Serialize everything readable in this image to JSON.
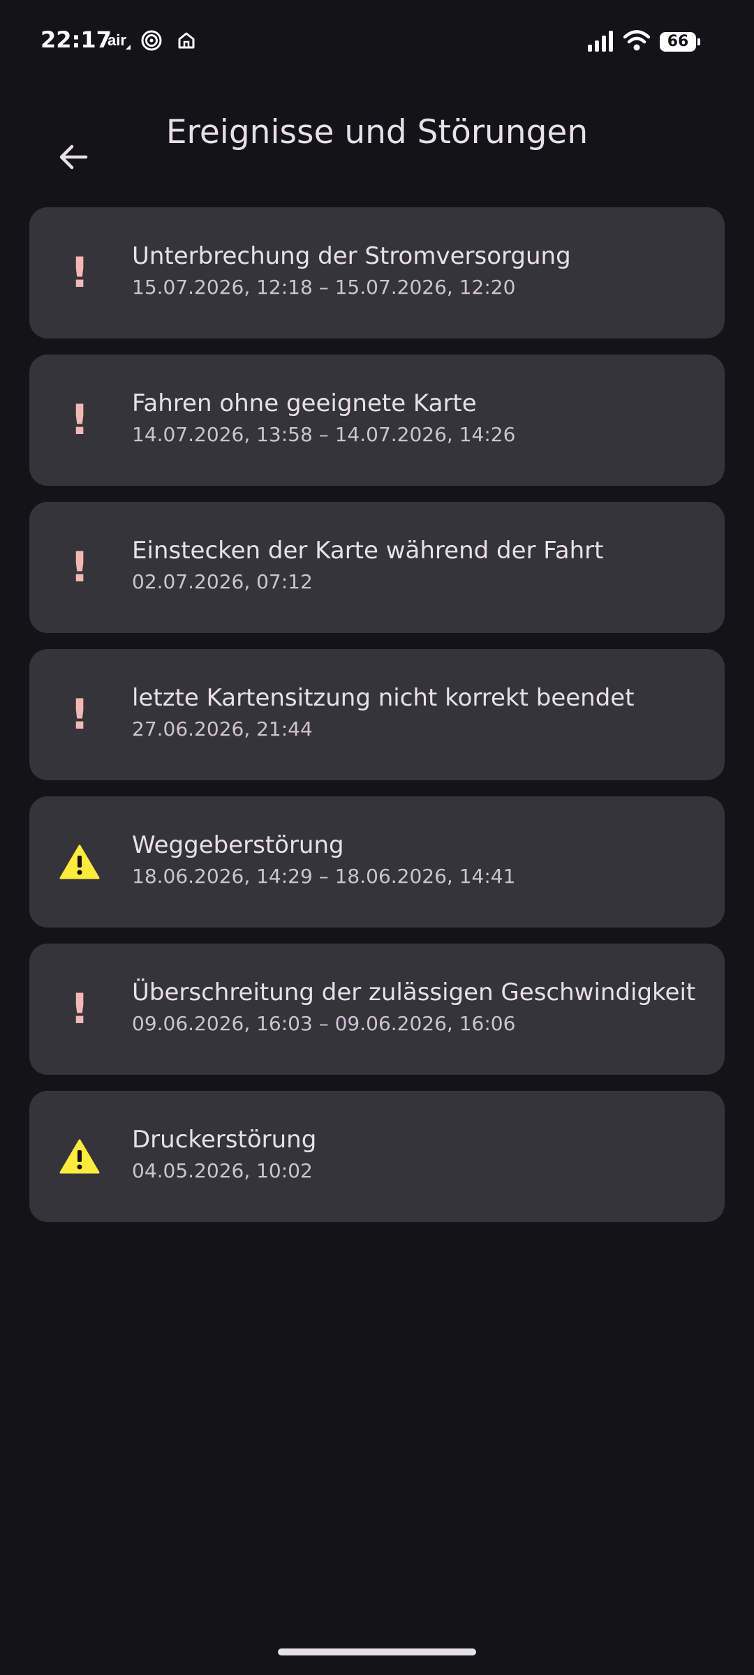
{
  "status_bar": {
    "time": "22:17",
    "air_label": "air",
    "battery_level": "66",
    "icons": [
      "air-icon",
      "spiral-icon",
      "home-icon",
      "signal-icon",
      "wifi-icon",
      "battery-icon"
    ]
  },
  "header": {
    "title": "Ereignisse und Störungen",
    "back_icon": "arrow-back-icon"
  },
  "events": [
    {
      "type": "error",
      "icon": "exclamation-icon",
      "title": "Unterbrechung der Stromversorgung",
      "time": "15.07.2026, 12:18 – 15.07.2026, 12:20"
    },
    {
      "type": "error",
      "icon": "exclamation-icon",
      "title": "Fahren ohne geeignete Karte",
      "time": "14.07.2026, 13:58 – 14.07.2026, 14:26"
    },
    {
      "type": "error",
      "icon": "exclamation-icon",
      "title": "Einstecken der Karte während der Fahrt",
      "time": "02.07.2026, 07:12"
    },
    {
      "type": "error",
      "icon": "exclamation-icon",
      "title": "letzte Kartensitzung nicht korrekt beendet",
      "time": "27.06.2026, 21:44"
    },
    {
      "type": "warning",
      "icon": "warning-triangle-icon",
      "title": "Weggeberstörung",
      "time": "18.06.2026, 14:29 – 18.06.2026, 14:41"
    },
    {
      "type": "error",
      "icon": "exclamation-icon",
      "title": "Überschreitung der zulässigen Geschwindigkeit",
      "time": "09.06.2026, 16:03 – 09.06.2026, 16:06"
    },
    {
      "type": "warning",
      "icon": "warning-triangle-icon",
      "title": "Druckerstörung",
      "time": "04.05.2026, 10:02"
    }
  ],
  "colors": {
    "background": "#141318",
    "card": "#36343b",
    "error_icon": "#f2b8b5",
    "warning_icon": "#ffeb3b"
  }
}
